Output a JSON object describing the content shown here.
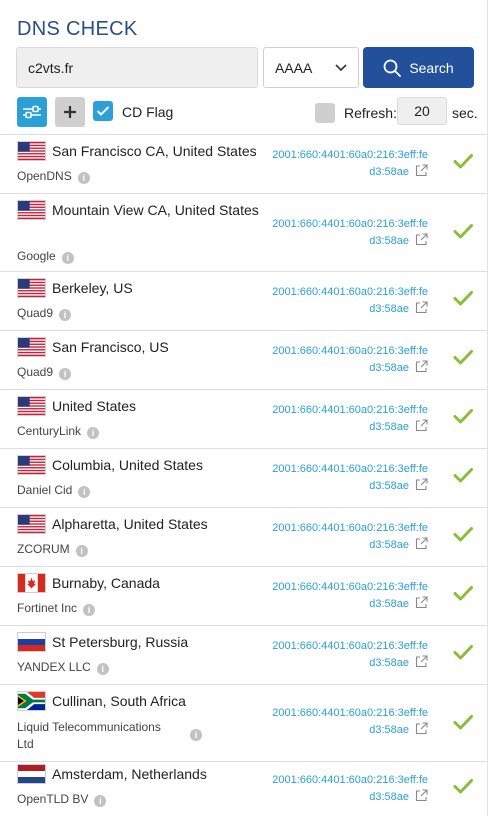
{
  "app": {
    "title": "DNS CHECK"
  },
  "search": {
    "domain": "c2vts.fr",
    "record_type": "AAAA",
    "button_label": "Search"
  },
  "options": {
    "cd_flag_label": "CD Flag",
    "cd_flag_checked": true,
    "refresh_label": "Refresh:",
    "refresh_value": "20",
    "refresh_unit": "sec."
  },
  "results": [
    {
      "flag": "us",
      "location": "San Francisco CA, United States",
      "provider": "OpenDNS",
      "ip_line1": "2001:660:4401:60a0:216:3eff:fe",
      "ip_line2": "d3:58ae",
      "status": "ok"
    },
    {
      "flag": "us",
      "location": "Mountain View CA, United States",
      "provider": "Google",
      "ip_line1": "2001:660:4401:60a0:216:3eff:fe",
      "ip_line2": "d3:58ae",
      "status": "ok"
    },
    {
      "flag": "us",
      "location": "Berkeley, US",
      "provider": "Quad9",
      "ip_line1": "2001:660:4401:60a0:216:3eff:fe",
      "ip_line2": "d3:58ae",
      "status": "ok"
    },
    {
      "flag": "us",
      "location": "San Francisco, US",
      "provider": "Quad9",
      "ip_line1": "2001:660:4401:60a0:216:3eff:fe",
      "ip_line2": "d3:58ae",
      "status": "ok"
    },
    {
      "flag": "us",
      "location": "United States",
      "provider": "CenturyLink",
      "ip_line1": "2001:660:4401:60a0:216:3eff:fe",
      "ip_line2": "d3:58ae",
      "status": "ok"
    },
    {
      "flag": "us",
      "location": "Columbia, United States",
      "provider": "Daniel Cid",
      "ip_line1": "2001:660:4401:60a0:216:3eff:fe",
      "ip_line2": "d3:58ae",
      "status": "ok"
    },
    {
      "flag": "us",
      "location": "Alpharetta, United States",
      "provider": "ZCORUM",
      "ip_line1": "2001:660:4401:60a0:216:3eff:fe",
      "ip_line2": "d3:58ae",
      "status": "ok"
    },
    {
      "flag": "ca",
      "location": "Burnaby, Canada",
      "provider": "Fortinet Inc",
      "ip_line1": "2001:660:4401:60a0:216:3eff:fe",
      "ip_line2": "d3:58ae",
      "status": "ok"
    },
    {
      "flag": "ru",
      "location": "St Petersburg, Russia",
      "provider": "YANDEX LLC",
      "ip_line1": "2001:660:4401:60a0:216:3eff:fe",
      "ip_line2": "d3:58ae",
      "status": "ok"
    },
    {
      "flag": "za",
      "location": "Cullinan, South Africa",
      "provider": "Liquid Telecommunications Ltd",
      "ip_line1": "2001:660:4401:60a0:216:3eff:fe",
      "ip_line2": "d3:58ae",
      "status": "ok"
    },
    {
      "flag": "nl",
      "location": "Amsterdam, Netherlands",
      "provider": "OpenTLD BV",
      "ip_line1": "2001:660:4401:60a0:216:3eff:fe",
      "ip_line2": "d3:58ae",
      "status": "ok"
    }
  ]
}
